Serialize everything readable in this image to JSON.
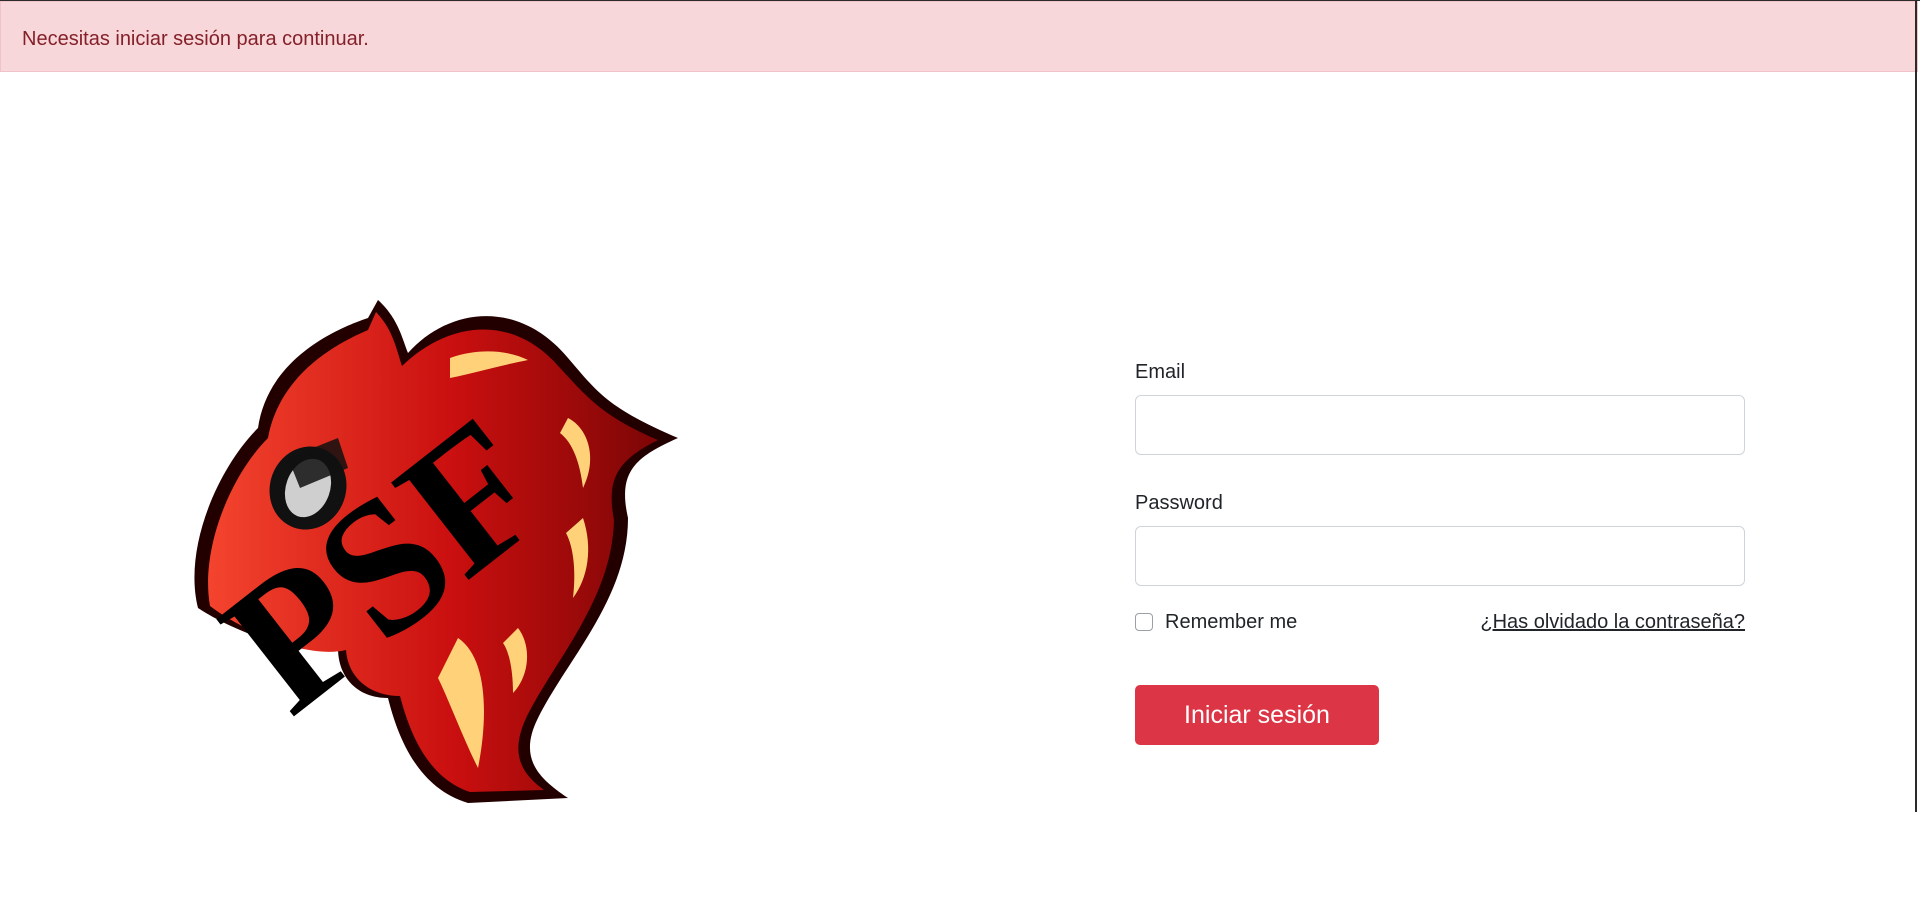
{
  "alert": {
    "message": "Necesitas iniciar sesión para continuar."
  },
  "logo": {
    "text": "PSF",
    "icon": "phoenix-mascot-logo",
    "colors": {
      "primary_red": "#e2261b",
      "dark_red": "#9d0a0a",
      "flame_yellow": "#ffd27a",
      "outline": "#1a0000"
    }
  },
  "form": {
    "email_label": "Email",
    "email_value": "",
    "password_label": "Password",
    "password_value": "",
    "remember_label": "Remember me",
    "remember_checked": false,
    "forgot_link": "¿Has olvidado la contraseña?",
    "submit_label": "Iniciar sesión"
  },
  "colors": {
    "alert_bg": "#f8d7da",
    "alert_text": "#842029",
    "button_bg": "#dc3545",
    "button_text": "#ffffff"
  }
}
